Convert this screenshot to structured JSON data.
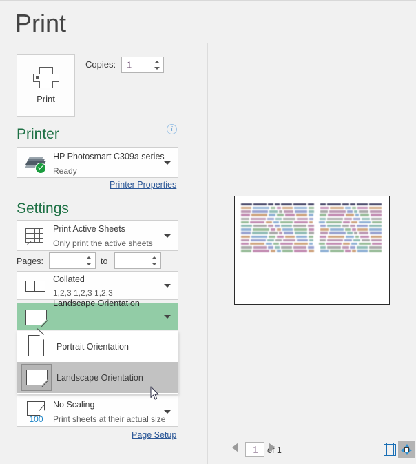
{
  "page": {
    "title": "Print"
  },
  "print_button": {
    "label": "Print",
    "icon": "printer-icon"
  },
  "copies": {
    "label": "Copies:",
    "value": "1"
  },
  "printer_section": {
    "heading": "Printer",
    "info_icon": "info-icon",
    "info_glyph": "i",
    "selected": {
      "name": "HP Photosmart C309a series",
      "status": "Ready",
      "icon": "printer-status-icon"
    },
    "properties_link": "Printer Properties"
  },
  "settings_section": {
    "heading": "Settings",
    "print_what": {
      "title": "Print Active Sheets",
      "subtitle": "Only print the active sheets",
      "icon": "sheet-grid-icon"
    },
    "pages": {
      "label": "Pages:",
      "from_value": "",
      "to_label": "to",
      "to_value": ""
    },
    "collation": {
      "title": "Collated",
      "subtitle": "1,2,3   1,2,3   1,2,3",
      "icon": "collate-icon"
    },
    "orientation": {
      "selected_label": "Landscape Orientation",
      "icon": "landscape-page-icon",
      "expanded": true,
      "options": [
        {
          "label": "Portrait Orientation",
          "icon": "portrait-page-icon",
          "selected": false
        },
        {
          "label": "Landscape Orientation",
          "icon": "landscape-page-icon",
          "selected": true
        }
      ]
    },
    "scaling": {
      "title": "No Scaling",
      "subtitle": "Print sheets at their actual size",
      "badge": "100",
      "icon": "scaling-page-icon"
    },
    "page_setup_link": "Page Setup"
  },
  "preview": {
    "page_number": "1",
    "of_label": "of 1",
    "prev_icon": "previous-page-arrow-icon",
    "next_icon": "next-page-arrow-icon",
    "show_margins_icon": "show-margins-icon",
    "zoom_to_page_icon": "zoom-to-page-icon"
  },
  "colors": {
    "accent_green": "#1d7044",
    "selection_green": "#92cca6",
    "link_blue": "#2b5797",
    "badge_blue": "#1a84c7",
    "status_green": "#1a9c3e",
    "background": "#f1f1f1"
  }
}
